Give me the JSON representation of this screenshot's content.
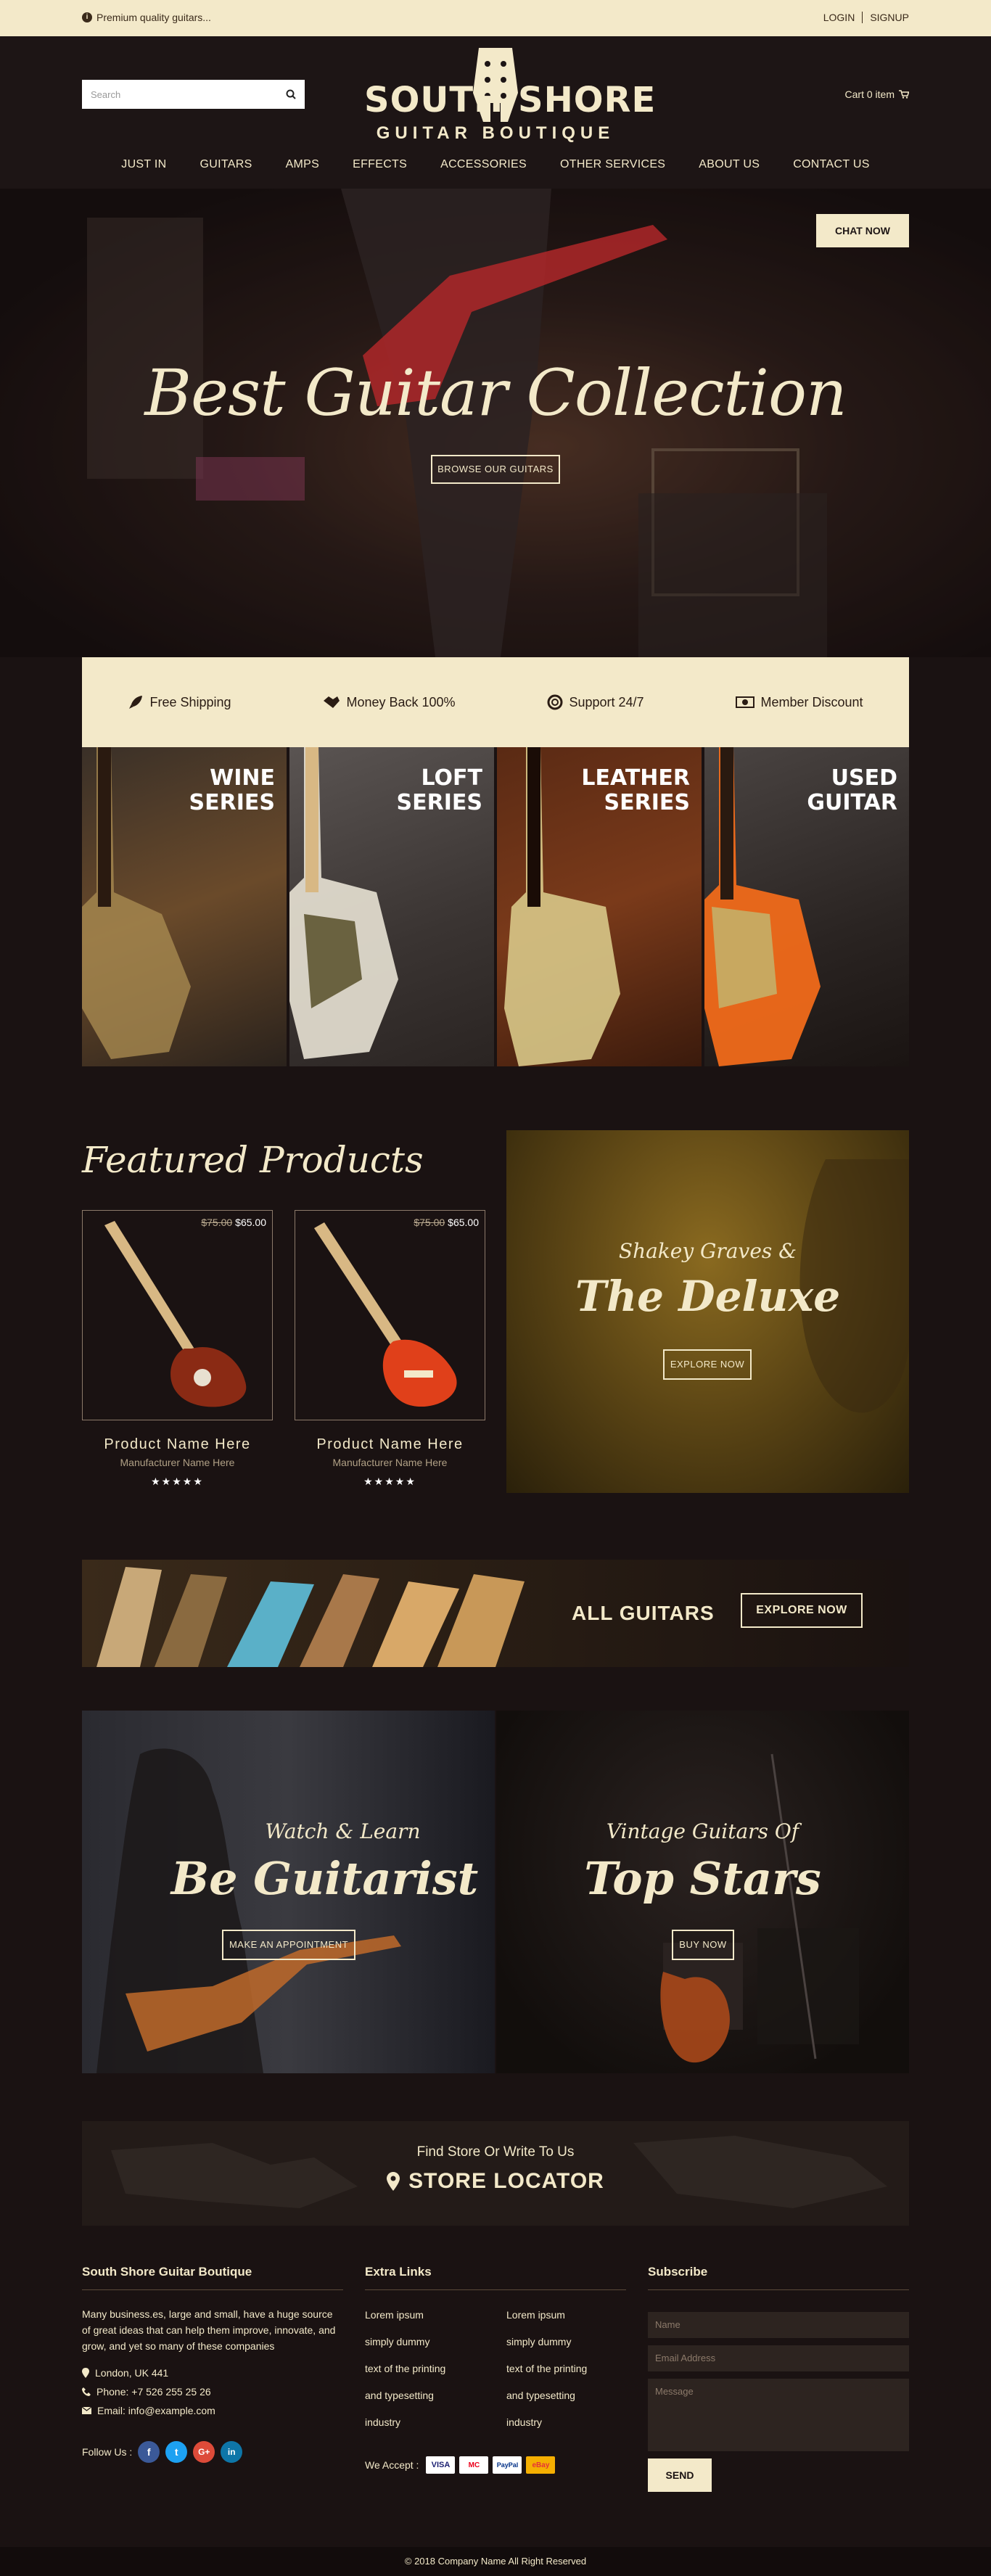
{
  "topbar": {
    "note": "Premium quality guitars...",
    "login": "LOGIN",
    "signup": "SIGNUP"
  },
  "header": {
    "search_placeholder": "Search",
    "logo_line1": "SOUTH",
    "logo_line2": "SHORE",
    "logo_sub": "GUITAR BOUTIQUE",
    "cart": "Cart 0 item"
  },
  "nav": [
    "JUST IN",
    "GUITARS",
    "AMPS",
    "EFFECTS",
    "ACCESSORIES",
    "OTHER SERVICES",
    "ABOUT US",
    "CONTACT US"
  ],
  "hero": {
    "title": "Best Guitar Collection",
    "button": "BROWSE OUR GUITARS",
    "chat": "CHAT NOW"
  },
  "features": [
    "Free Shipping",
    "Money Back 100%",
    "Support 24/7",
    "Member Discount"
  ],
  "series": [
    {
      "l1": "WINE",
      "l2": "SERIES"
    },
    {
      "l1": "LOFT",
      "l2": "SERIES"
    },
    {
      "l1": "LEATHER",
      "l2": "SERIES"
    },
    {
      "l1": "USED",
      "l2": "GUITAR"
    }
  ],
  "featured": {
    "title": "Featured Products",
    "products": [
      {
        "old": "$75.00",
        "price": "$65.00",
        "name": "Product Name Here",
        "manufacturer": "Manufacturer Name Here",
        "stars": "★★★★★"
      },
      {
        "old": "$75.00",
        "price": "$65.00",
        "name": "Product Name Here",
        "manufacturer": "Manufacturer Name Here",
        "stars": "★★★★★"
      }
    ]
  },
  "deluxe": {
    "kicker": "Shakey Graves &",
    "title": "The Deluxe",
    "button": "EXPLORE NOW"
  },
  "all_guitars": {
    "title": "ALL GUITARS",
    "button": "EXPLORE NOW"
  },
  "split": [
    {
      "kicker": "Watch & Learn",
      "title": "Be Guitarist",
      "button": "MAKE AN APPOINTMENT"
    },
    {
      "kicker": "Vintage Guitars Of",
      "title": "Top Stars",
      "button": "BUY NOW"
    }
  ],
  "store": {
    "kicker": "Find Store Or Write To Us",
    "title": "STORE LOCATOR"
  },
  "footer": {
    "about_title": "South Shore Guitar Boutique",
    "about_text": "Many business.es, large and small, have a huge source of great ideas that can help them improve, innovate, and grow, and yet so many of these companies",
    "address": "London, UK 441",
    "phone": "Phone: +7 526 255 25 26",
    "email": "Email: info@example.com",
    "follow": "Follow Us :",
    "links_title": "Extra Links",
    "links_col1": [
      "Lorem ipsum",
      "simply dummy",
      "text of the printing",
      "and typesetting",
      "industry"
    ],
    "links_col2": [
      "Lorem ipsum",
      "simply dummy",
      "text of the printing",
      "and typesetting",
      "industry"
    ],
    "we_accept": "We Accept :",
    "cards": [
      "VISA",
      "MC",
      "PayPal",
      "eBay"
    ],
    "subscribe_title": "Subscribe",
    "name_ph": "Name",
    "email_ph": "Email Address",
    "message_ph": "Message",
    "send": "SEND",
    "copyright": "© 2018 Company Name All Right Reserved"
  },
  "colors": {
    "cream": "#f3e9c9",
    "dark": "#1d1515"
  }
}
